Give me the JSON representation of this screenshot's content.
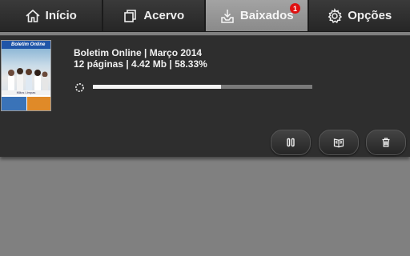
{
  "nav": {
    "tabs": [
      {
        "label": "Início",
        "icon": "home-icon"
      },
      {
        "label": "Acervo",
        "icon": "collection-icon"
      },
      {
        "label": "Baixados",
        "icon": "downloaded-icon",
        "badge": "1",
        "active": true
      },
      {
        "label": "Opções",
        "icon": "gear-icon"
      }
    ]
  },
  "download": {
    "cover": {
      "title": "Boletim Online",
      "caption": "Mãos Limpas"
    },
    "title": "Boletim Online | Março 2014",
    "meta": "12 páginas | 4.42 Mb | 58.33%",
    "progress_percent": 58.33
  },
  "actions": {
    "pause_icon": "pause-icon",
    "read_icon": "open-book-icon",
    "delete_icon": "trash-icon"
  },
  "colors": {
    "background": "#808080",
    "bar": "#2b2b2b",
    "active_tab": "#9a9a9a",
    "badge": "#e01010",
    "card": "#2e2e2e"
  }
}
